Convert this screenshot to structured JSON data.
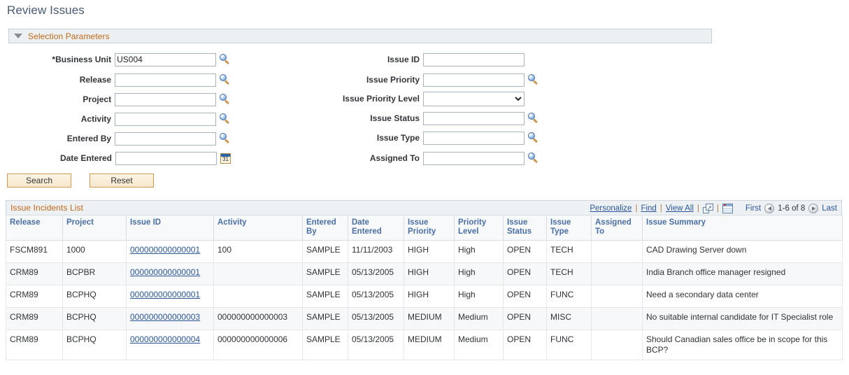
{
  "page": {
    "title": "Review Issues"
  },
  "selection_parameters": {
    "group_label": "Selection Parameters",
    "collapse_icon": "triangle-down-icon",
    "left_fields": [
      {
        "label": "*Business Unit",
        "value": "US004",
        "placeholder": "",
        "widget": "text-with-prompt",
        "icon": "magnifier-icon"
      },
      {
        "label": "Release",
        "value": "",
        "placeholder": "",
        "widget": "text-with-prompt",
        "icon": "magnifier-icon"
      },
      {
        "label": "Project",
        "value": "",
        "placeholder": "",
        "widget": "text-with-prompt",
        "icon": "magnifier-icon"
      },
      {
        "label": "Activity",
        "value": "",
        "placeholder": "",
        "widget": "text-with-prompt",
        "icon": "magnifier-icon"
      },
      {
        "label": "Entered By",
        "value": "",
        "placeholder": "",
        "widget": "text-with-prompt",
        "icon": "magnifier-icon"
      },
      {
        "label": "Date Entered",
        "value": "",
        "placeholder": "",
        "widget": "date",
        "icon": "calendar-icon",
        "calendar_day": "31"
      }
    ],
    "right_fields": [
      {
        "label": "Issue ID",
        "value": "",
        "placeholder": "",
        "widget": "text",
        "icon": ""
      },
      {
        "label": "Issue Priority",
        "value": "",
        "placeholder": "",
        "widget": "text-with-prompt",
        "icon": "magnifier-icon"
      },
      {
        "label": "Issue Priority Level",
        "value": "",
        "placeholder": "",
        "widget": "dropdown",
        "icon": "chevron-down-icon",
        "selected_option": ""
      },
      {
        "label": "Issue Status",
        "value": "",
        "placeholder": "",
        "widget": "text-with-prompt",
        "icon": "magnifier-icon"
      },
      {
        "label": "Issue Type",
        "value": "",
        "placeholder": "",
        "widget": "text-with-prompt",
        "icon": "magnifier-icon"
      },
      {
        "label": "Assigned To",
        "value": "",
        "placeholder": "",
        "widget": "text-with-prompt",
        "icon": "magnifier-icon"
      }
    ],
    "buttons": {
      "search_label": "Search",
      "reset_label": "Reset"
    }
  },
  "grid": {
    "title": "Issue Incidents List",
    "tools": {
      "personalize": "Personalize",
      "find": "Find",
      "view_all": "View All",
      "separator": "|",
      "expand_icon": "expand-window-icon",
      "spreadsheet_icon": "download-spreadsheet-icon"
    },
    "pager": {
      "first_label": "First",
      "prev_icon": "previous-arrow-icon",
      "range": "1-6 of 8",
      "next_icon": "next-arrow-icon",
      "last_label": "Last"
    },
    "columns": [
      "Release",
      "Project",
      "Issue ID",
      "Activity",
      "Entered By",
      "Date Entered",
      "Issue Priority",
      "Priority Level",
      "Issue Status",
      "Issue Type",
      "Assigned To",
      "Issue Summary"
    ],
    "rows": [
      {
        "release": "FSCM891",
        "project": "1000",
        "issue_id": "000000000000001",
        "activity": "100",
        "entered_by": "SAMPLE",
        "date_entered": "11/11/2003",
        "issue_priority": "HIGH",
        "priority_level": "High",
        "issue_status": "OPEN",
        "issue_type": "TECH",
        "assigned_to": "",
        "issue_summary": "CAD Drawing Server down"
      },
      {
        "release": "CRM89",
        "project": "BCPBR",
        "issue_id": "000000000000001",
        "activity": "",
        "entered_by": "SAMPLE",
        "date_entered": "05/13/2005",
        "issue_priority": "HIGH",
        "priority_level": "High",
        "issue_status": "OPEN",
        "issue_type": "TECH",
        "assigned_to": "",
        "issue_summary": "India Branch office manager resigned"
      },
      {
        "release": "CRM89",
        "project": "BCPHQ",
        "issue_id": "000000000000001",
        "activity": "",
        "entered_by": "SAMPLE",
        "date_entered": "05/13/2005",
        "issue_priority": "HIGH",
        "priority_level": "High",
        "issue_status": "OPEN",
        "issue_type": "FUNC",
        "assigned_to": "",
        "issue_summary": "Need a secondary data center"
      },
      {
        "release": "CRM89",
        "project": "BCPHQ",
        "issue_id": "000000000000003",
        "activity": "000000000000003",
        "entered_by": "SAMPLE",
        "date_entered": "05/13/2005",
        "issue_priority": "MEDIUM",
        "priority_level": "Medium",
        "issue_status": "OPEN",
        "issue_type": "MISC",
        "assigned_to": "",
        "issue_summary": "No suitable internal candidate for IT Specialist role"
      },
      {
        "release": "CRM89",
        "project": "BCPHQ",
        "issue_id": "000000000000004",
        "activity": "000000000000006",
        "entered_by": "SAMPLE",
        "date_entered": "05/13/2005",
        "issue_priority": "MEDIUM",
        "priority_level": "Medium",
        "issue_status": "OPEN",
        "issue_type": "FUNC",
        "assigned_to": "",
        "issue_summary": "Should Canadian sales office be in scope for this BCP?"
      }
    ]
  },
  "colors": {
    "title_text": "#4a5a73",
    "group_header_text": "#c06818",
    "group_header_bg": "#eef1f4",
    "link": "#2a5699",
    "column_header_text": "#4a6fa5",
    "button_border": "#d09a4e",
    "row_alt_bg": "#f7f8f9"
  }
}
